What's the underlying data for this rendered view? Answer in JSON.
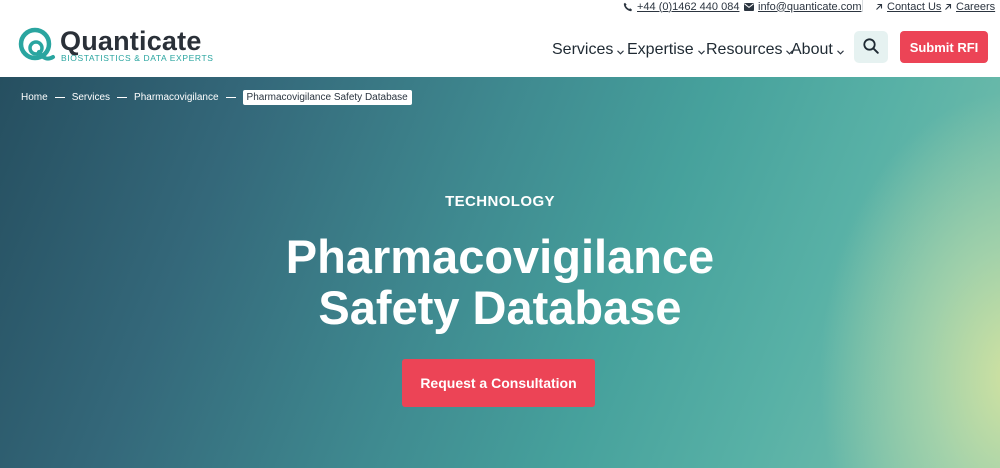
{
  "utility": {
    "phone": "+44 (0)1462 440 084",
    "email": "info@quanticate.com",
    "contact": "Contact Us",
    "careers": "Careers"
  },
  "logo": {
    "name": "Quanticate",
    "tagline": "BIOSTATISTICS & DATA EXPERTS"
  },
  "nav": {
    "items": [
      "Services",
      "Expertise",
      "Resources",
      "About"
    ],
    "search_icon": "search-icon",
    "submit_rfi": "Submit RFI"
  },
  "breadcrumb": {
    "items": [
      "Home",
      "Services",
      "Pharmacovigilance"
    ],
    "current": "Pharmacovigilance Safety Database"
  },
  "hero": {
    "eyebrow": "TECHNOLOGY",
    "title_line1": "Pharmacovigilance",
    "title_line2": "Safety Database",
    "cta": "Request a Consultation"
  },
  "colors": {
    "accent": "#ec4456",
    "teal": "#2aa5a0",
    "search_bg": "#e6f2f1"
  }
}
